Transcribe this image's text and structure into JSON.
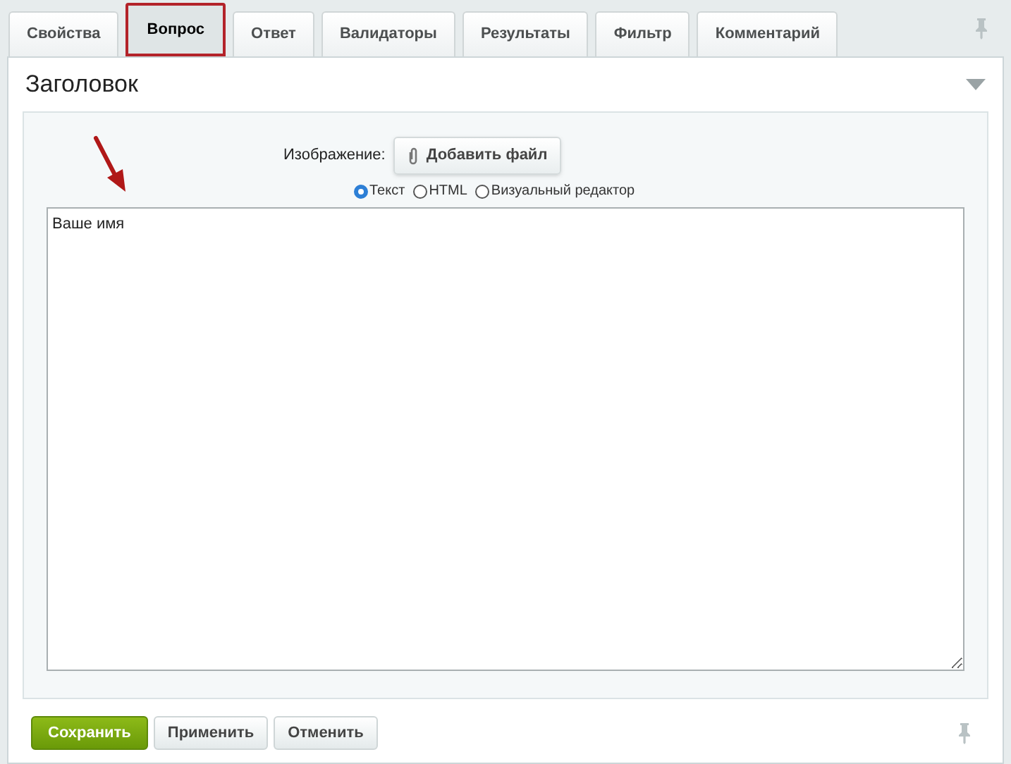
{
  "tabs": [
    {
      "label": "Свойства",
      "selected": false
    },
    {
      "label": "Вопрос",
      "selected": true
    },
    {
      "label": "Ответ",
      "selected": false
    },
    {
      "label": "Валидаторы",
      "selected": false
    },
    {
      "label": "Результаты",
      "selected": false
    },
    {
      "label": "Фильтр",
      "selected": false
    },
    {
      "label": "Комментарий",
      "selected": false
    }
  ],
  "section": {
    "title": "Заголовок",
    "expanded": true
  },
  "image": {
    "label": "Изображение:",
    "button": "Добавить файл"
  },
  "modes": [
    {
      "label": "Текст",
      "selected": true
    },
    {
      "label": "HTML",
      "selected": false
    },
    {
      "label": "Визуальный редактор",
      "selected": false
    }
  ],
  "text": {
    "value": "Ваше имя"
  },
  "buttons": [
    {
      "label": "Сохранить",
      "kind": "primary"
    },
    {
      "label": "Применить",
      "kind": "default"
    },
    {
      "label": "Отменить",
      "kind": "default"
    }
  ]
}
